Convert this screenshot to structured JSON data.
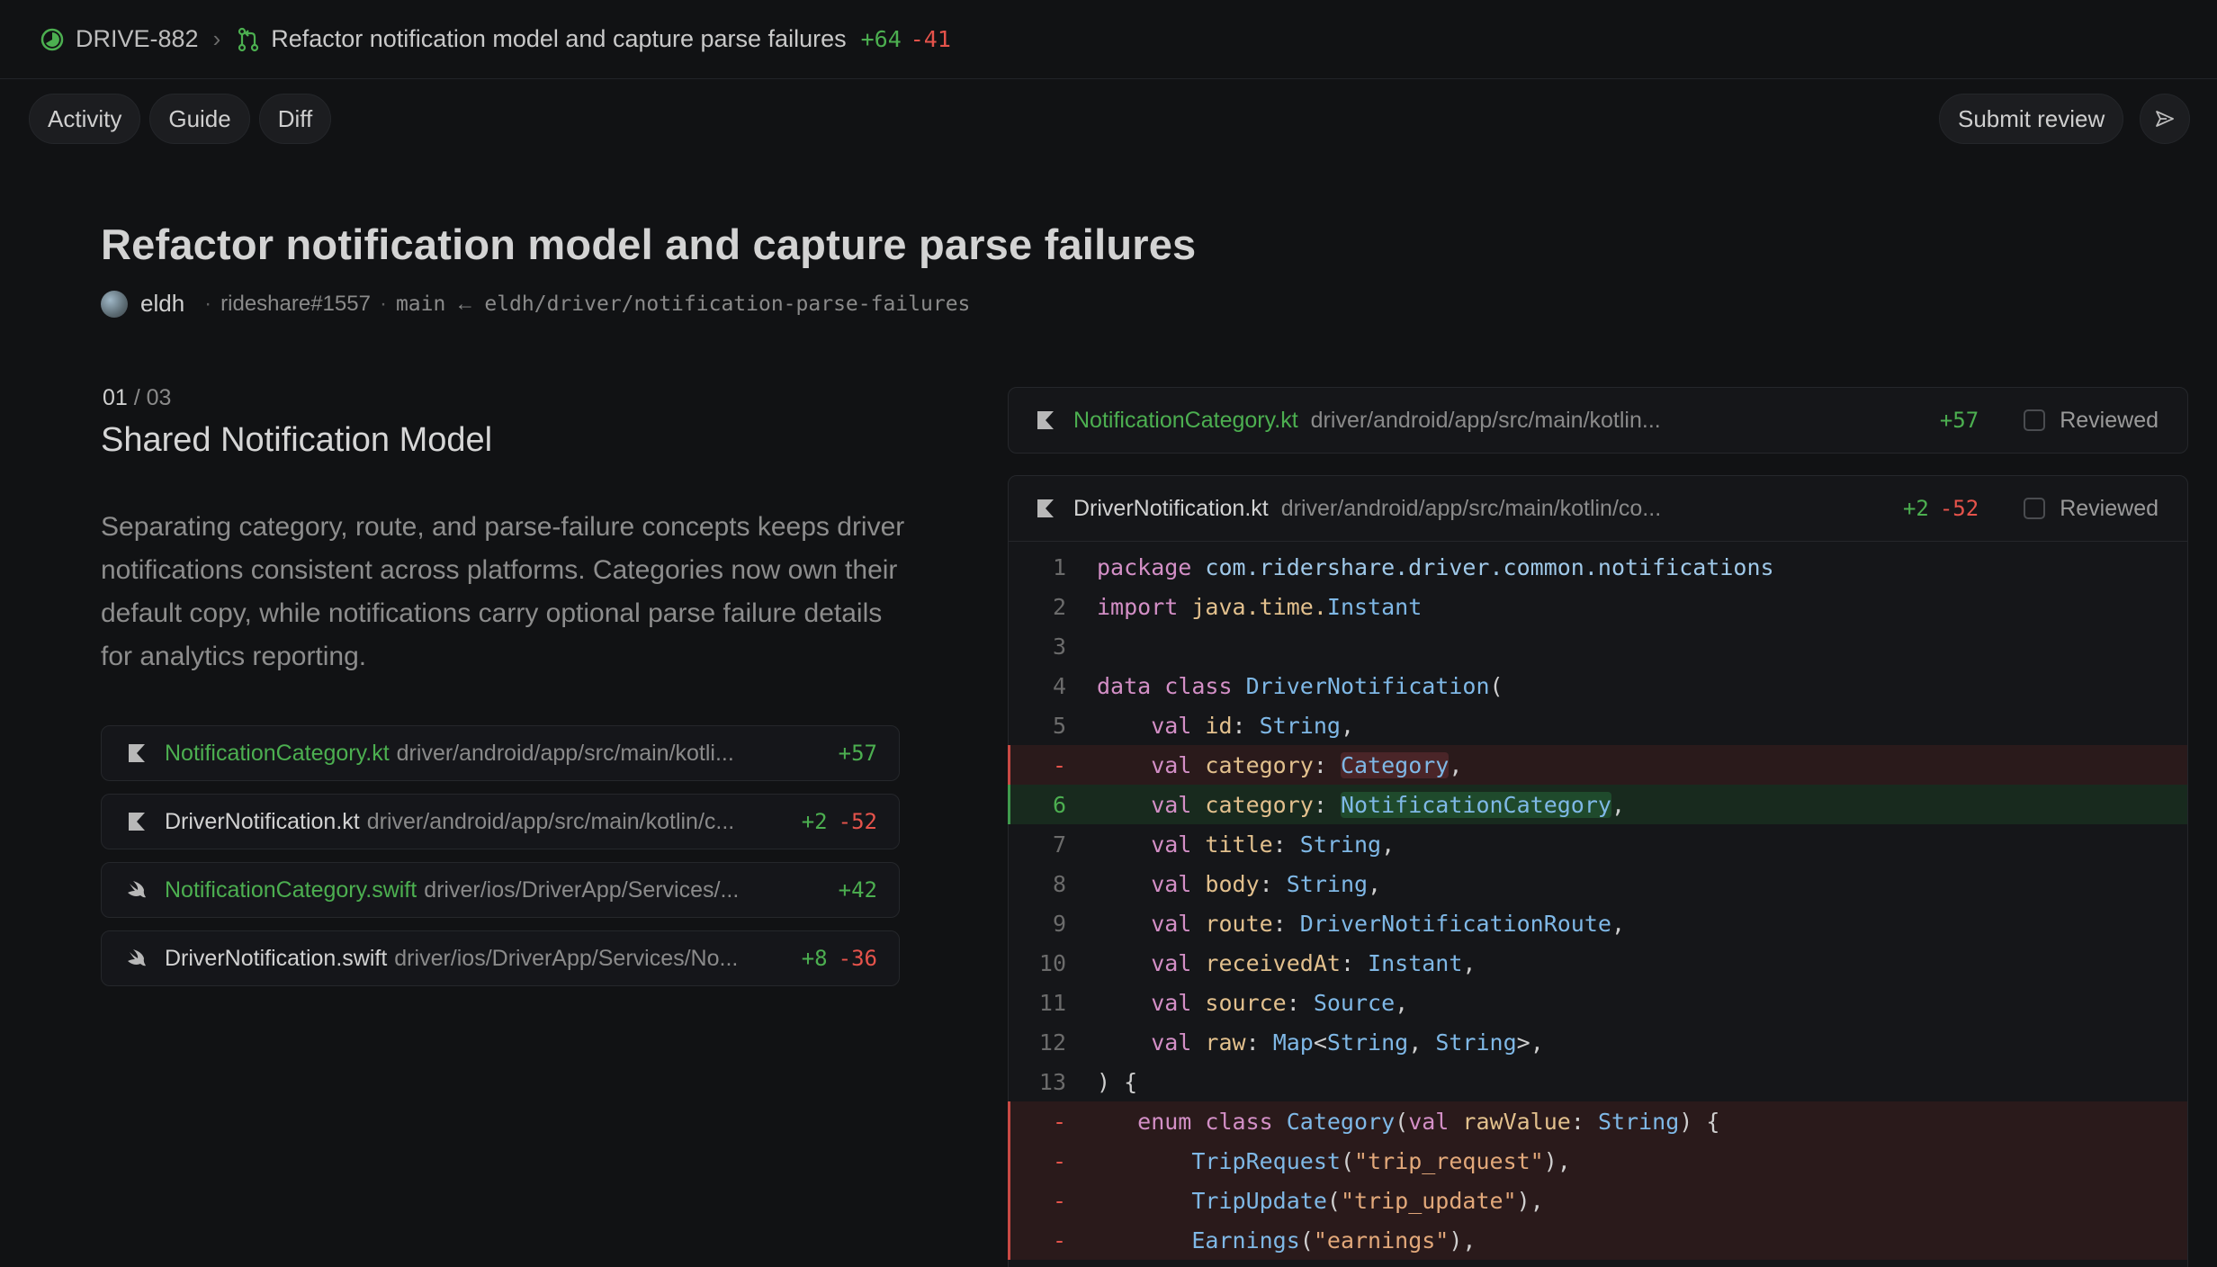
{
  "topbar": {
    "ticket": "DRIVE-882",
    "pr_title": "Refactor notification model and capture parse failures",
    "additions": "+64",
    "deletions": "-41"
  },
  "tabs": [
    "Activity",
    "Guide",
    "Diff"
  ],
  "actions": {
    "submit_review": "Submit review"
  },
  "header": {
    "title": "Refactor notification model and capture parse failures",
    "author": "eldh",
    "repo_ref": "rideshare#1557",
    "base": "main",
    "arrow": "←",
    "head": "eldh/driver/notification-parse-failures"
  },
  "guide": {
    "step_current": "01",
    "step_total": "/ 03",
    "section_title": "Shared Notification Model",
    "description": "Separating category, route, and parse-failure concepts keeps driver notifications consistent across platforms. Categories now own their default copy, while notifications carry optional parse failure details for analytics reporting.",
    "files": [
      {
        "icon": "kotlin-icon",
        "name": "NotificationCategory.kt",
        "path": "driver/android/app/src/main/kotli...",
        "add": "+57",
        "del": "",
        "green": true
      },
      {
        "icon": "kotlin-icon",
        "name": "DriverNotification.kt",
        "path": "driver/android/app/src/main/kotlin/c...",
        "add": "+2",
        "del": "-52",
        "green": false
      },
      {
        "icon": "swift-icon",
        "name": "NotificationCategory.swift",
        "path": "driver/ios/DriverApp/Services/...",
        "add": "+42",
        "del": "",
        "green": true
      },
      {
        "icon": "swift-icon",
        "name": "DriverNotification.swift",
        "path": "driver/ios/DriverApp/Services/No...",
        "add": "+8",
        "del": "-36",
        "green": false
      }
    ]
  },
  "diff": {
    "reviewed_label": "Reviewed",
    "file1": {
      "name": "NotificationCategory.kt",
      "path": "driver/android/app/src/main/kotlin...",
      "add": "+57"
    },
    "file2": {
      "name": "DriverNotification.kt",
      "path": "driver/android/app/src/main/kotlin/co...",
      "add": "+2",
      "del": "-52"
    },
    "lines": [
      {
        "n": "1",
        "t": "normal"
      },
      {
        "n": "2",
        "t": "normal"
      },
      {
        "n": "3",
        "t": "normal"
      },
      {
        "n": "4",
        "t": "normal"
      },
      {
        "n": "5",
        "t": "normal"
      },
      {
        "n": "-",
        "t": "removed"
      },
      {
        "n": "6",
        "t": "added"
      },
      {
        "n": "7",
        "t": "normal"
      },
      {
        "n": "8",
        "t": "normal"
      },
      {
        "n": "9",
        "t": "normal"
      },
      {
        "n": "10",
        "t": "normal"
      },
      {
        "n": "11",
        "t": "normal"
      },
      {
        "n": "12",
        "t": "normal"
      },
      {
        "n": "13",
        "t": "normal"
      },
      {
        "n": "-",
        "t": "removed"
      },
      {
        "n": "-",
        "t": "removed"
      },
      {
        "n": "-",
        "t": "removed"
      },
      {
        "n": "-",
        "t": "removed"
      }
    ],
    "code": {
      "l1": [
        "package",
        " com.ridershare.driver.common.notifications"
      ],
      "l2": [
        "import",
        " java.time.",
        "Instant"
      ],
      "l4": [
        "data",
        " class",
        " DriverNotification",
        "("
      ],
      "l5": [
        "    val",
        " id",
        ": ",
        "String",
        ","
      ],
      "l5r": [
        "    val",
        " category",
        ": ",
        "Category",
        ","
      ],
      "l6": [
        "    val",
        " category",
        ": ",
        "NotificationCategory",
        ","
      ],
      "l7": [
        "    val",
        " title",
        ": ",
        "String",
        ","
      ],
      "l8": [
        "    val",
        " body",
        ": ",
        "String",
        ","
      ],
      "l9": [
        "    val",
        " route",
        ": ",
        "DriverNotificationRoute",
        ","
      ],
      "l10": [
        "    val",
        " receivedAt",
        ": ",
        "Instant",
        ","
      ],
      "l11": [
        "    val",
        " source",
        ": ",
        "Source",
        ","
      ],
      "l12": [
        "    val",
        " raw",
        ": ",
        "Map",
        "<",
        "String",
        ", ",
        "String",
        ">,"
      ],
      "l13": [
        ") {"
      ],
      "r1": [
        "   enum",
        " class",
        " Category",
        "(",
        "val",
        " rawValue",
        ": ",
        "String",
        ") {"
      ],
      "r2": [
        "       TripRequest",
        "(",
        "\"trip_request\"",
        "),"
      ],
      "r3": [
        "       TripUpdate",
        "(",
        "\"trip_update\"",
        "),"
      ],
      "r4": [
        "       Earnings",
        "(",
        "\"earnings\"",
        "),"
      ]
    }
  }
}
